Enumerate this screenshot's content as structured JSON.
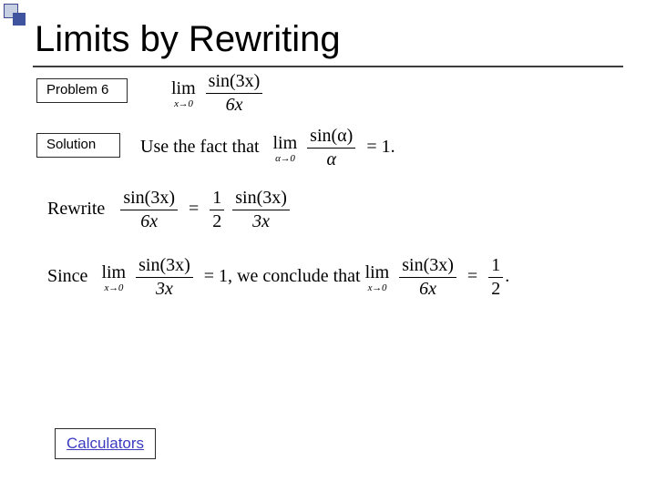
{
  "title": "Limits by Rewriting",
  "labels": {
    "problem": "Problem 6",
    "solution": "Solution"
  },
  "link": {
    "calculators": "Calculators"
  },
  "math": {
    "lim_word": "lim",
    "x_to_0": "x→0",
    "alpha_to_0": "α→0",
    "sin3x": "sin(3x)",
    "six_x": "6x",
    "three_x": "3x",
    "sin_alpha": "sin(α)",
    "alpha": "α",
    "use_fact": "Use the fact that",
    "eq1_tail": "= 1.",
    "rewrite": "Rewrite",
    "eq_half_pre": "=",
    "one": "1",
    "two": "2",
    "since": "Since",
    "eq1_comma": "= 1,",
    "conclude": " we conclude that ",
    "eq_half_period": "."
  }
}
